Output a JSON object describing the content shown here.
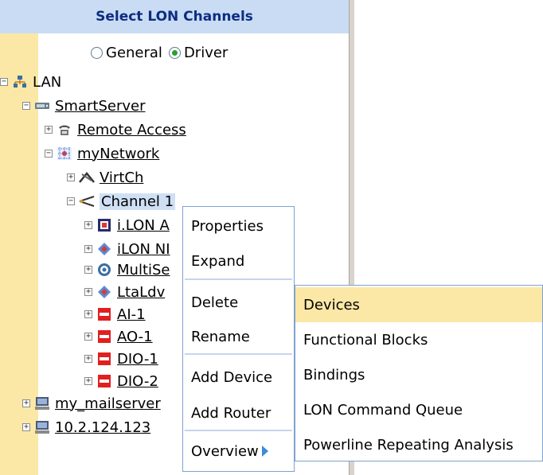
{
  "panel": {
    "title": "Select LON Channels"
  },
  "radios": [
    {
      "label": "General",
      "checked": false
    },
    {
      "label": "Driver",
      "checked": true
    }
  ],
  "tree": {
    "lan": "LAN",
    "smartserver": "SmartServer",
    "remote_access": "Remote Access",
    "mynetwork": "myNetwork",
    "virtch": "VirtCh",
    "channel1": "Channel 1",
    "ilon_a": "i.LON A",
    "ilon_ni": "iLON NI",
    "multise": "MultiSe",
    "ltaldv": "LtaLdv",
    "ai1": "AI-1",
    "ao1": "AO-1",
    "dio1": "DIO-1",
    "dio2": "DIO-2",
    "mailserver": "my_mailserver",
    "ip": "10.2.124.123"
  },
  "context_menu": {
    "items": [
      "Properties",
      "Expand",
      "Delete",
      "Rename",
      "Add Device",
      "Add Router",
      "Overview"
    ]
  },
  "submenu": {
    "items": [
      "Devices",
      "Functional Blocks",
      "Bindings",
      "LON Command Queue",
      "Powerline Repeating Analysis"
    ],
    "highlighted_index": 0
  },
  "colors": {
    "header_bg": "#c9dcf3",
    "header_text": "#0c2d83",
    "left_strip": "#fbe8a6",
    "menu_border": "#7da2ce",
    "highlight": "#fbe8a6",
    "selection": "#cfe0f5"
  }
}
